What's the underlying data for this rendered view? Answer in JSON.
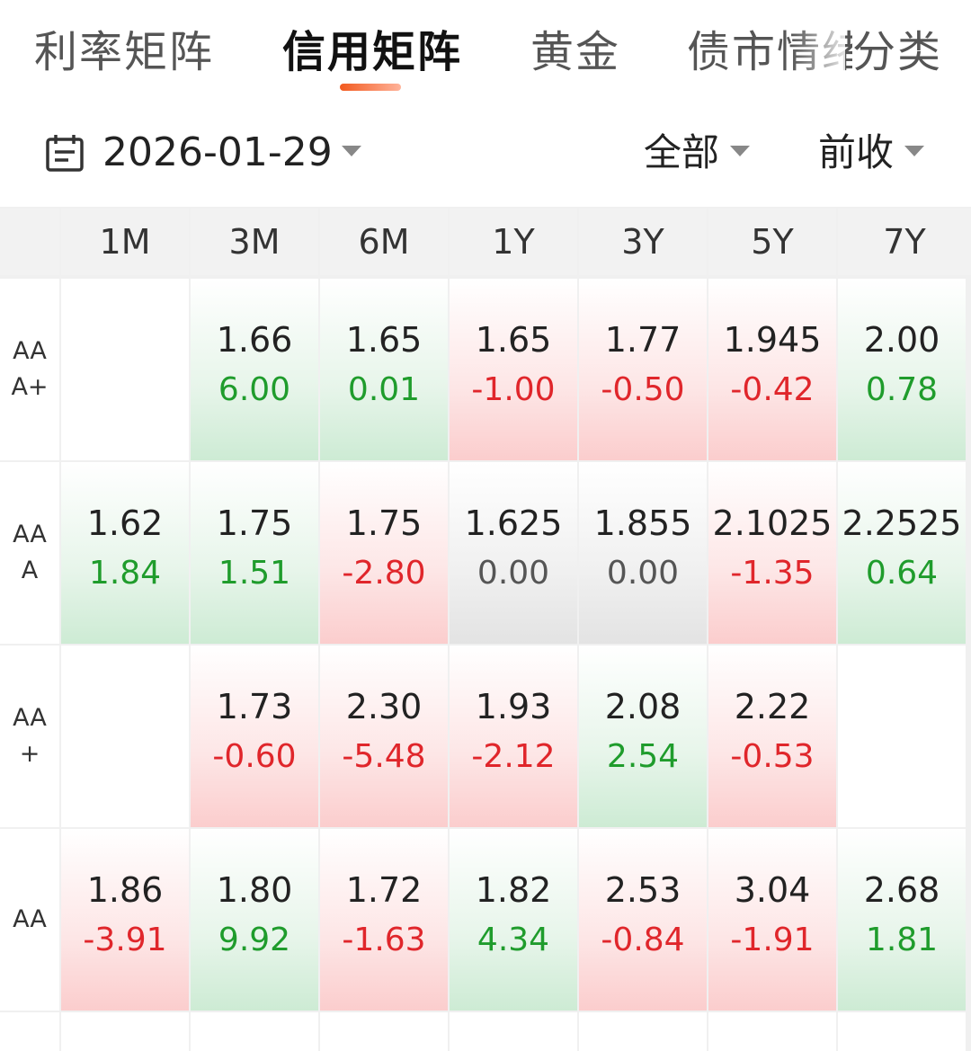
{
  "tabs": [
    {
      "label": "利率矩阵",
      "active": false
    },
    {
      "label": "信用矩阵",
      "active": true
    },
    {
      "label": "黄金",
      "active": false
    },
    {
      "label": "债市情绪",
      "active": false
    },
    {
      "label": "分类",
      "active": false
    }
  ],
  "filters": {
    "date": "2026-01-29",
    "scope": "全部",
    "basis": "前收"
  },
  "columns": [
    "1M",
    "3M",
    "6M",
    "1Y",
    "3Y",
    "5Y",
    "7Y"
  ],
  "rows": [
    {
      "label": "AAA+",
      "cells": [
        null,
        {
          "yield": "1.66",
          "change": "6.00",
          "dir": "down"
        },
        {
          "yield": "1.65",
          "change": "0.01",
          "dir": "down"
        },
        {
          "yield": "1.65",
          "change": "-1.00",
          "dir": "up"
        },
        {
          "yield": "1.77",
          "change": "-0.50",
          "dir": "up"
        },
        {
          "yield": "1.945",
          "change": "-0.42",
          "dir": "up"
        },
        {
          "yield": "2.00",
          "change": "0.78",
          "dir": "down"
        }
      ]
    },
    {
      "label": "AAA",
      "cells": [
        {
          "yield": "1.62",
          "change": "1.84",
          "dir": "down"
        },
        {
          "yield": "1.75",
          "change": "1.51",
          "dir": "down"
        },
        {
          "yield": "1.75",
          "change": "-2.80",
          "dir": "up"
        },
        {
          "yield": "1.625",
          "change": "0.00",
          "dir": "flat"
        },
        {
          "yield": "1.855",
          "change": "0.00",
          "dir": "flat"
        },
        {
          "yield": "2.1025",
          "change": "-1.35",
          "dir": "up"
        },
        {
          "yield": "2.2525",
          "change": "0.64",
          "dir": "down"
        }
      ]
    },
    {
      "label": "AA+",
      "cells": [
        null,
        {
          "yield": "1.73",
          "change": "-0.60",
          "dir": "up"
        },
        {
          "yield": "2.30",
          "change": "-5.48",
          "dir": "up"
        },
        {
          "yield": "1.93",
          "change": "-2.12",
          "dir": "up"
        },
        {
          "yield": "2.08",
          "change": "2.54",
          "dir": "down"
        },
        {
          "yield": "2.22",
          "change": "-0.53",
          "dir": "up"
        },
        null
      ]
    },
    {
      "label": "AA",
      "cells": [
        {
          "yield": "1.86",
          "change": "-3.91",
          "dir": "up"
        },
        {
          "yield": "1.80",
          "change": "9.92",
          "dir": "down"
        },
        {
          "yield": "1.72",
          "change": "-1.63",
          "dir": "up"
        },
        {
          "yield": "1.82",
          "change": "4.34",
          "dir": "down"
        },
        {
          "yield": "2.53",
          "change": "-0.84",
          "dir": "up"
        },
        {
          "yield": "3.04",
          "change": "-1.91",
          "dir": "up"
        },
        {
          "yield": "2.68",
          "change": "1.81",
          "dir": "down"
        }
      ]
    }
  ]
}
